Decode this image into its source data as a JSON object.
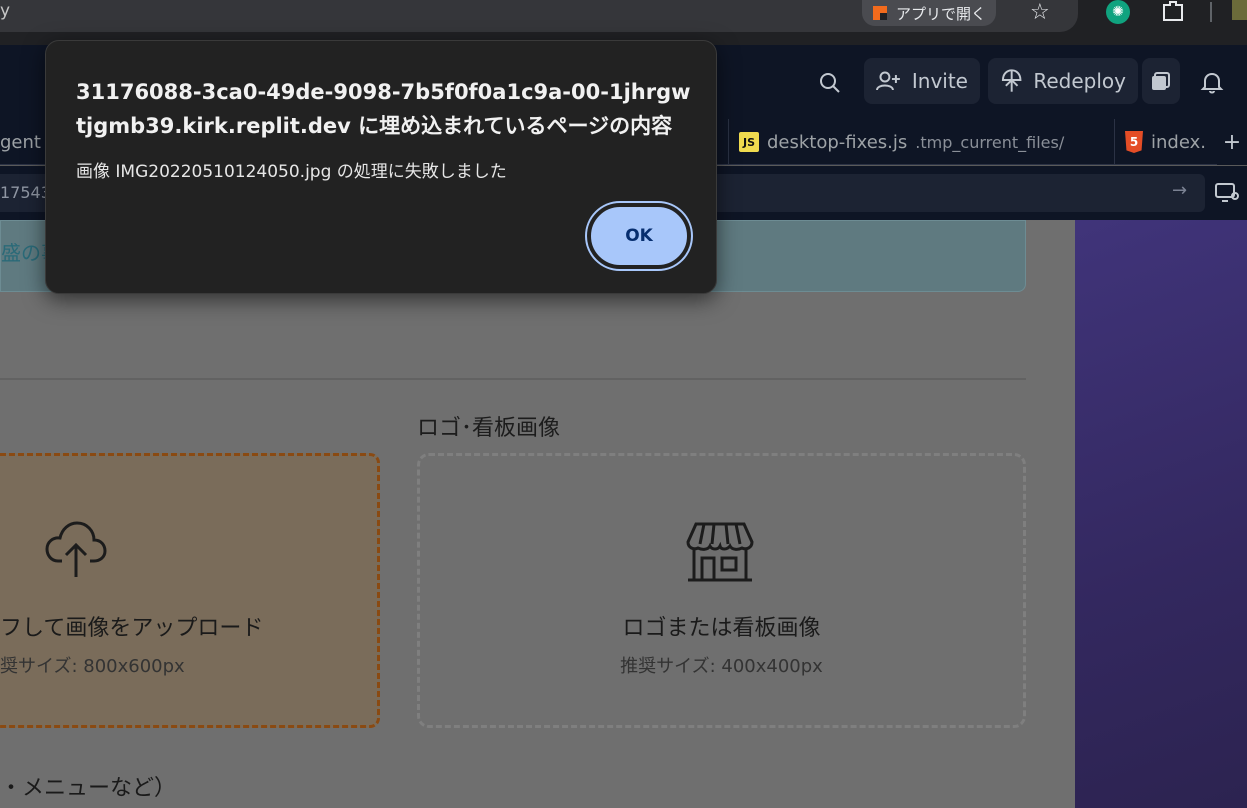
{
  "browser": {
    "url_fragment": "y",
    "open_app_label": "アプリで開く",
    "icons": [
      "app-logo-icon",
      "star-icon",
      "chatgpt-icon",
      "extensions-icon",
      "profile-icon"
    ]
  },
  "replit_header": {
    "invite_label": "Invite",
    "redeploy_label": "Redeploy",
    "icons": [
      "search-icon",
      "add-user-icon",
      "deploy-icon",
      "window-icon",
      "bell-icon"
    ]
  },
  "tabs": [
    {
      "label": "gent",
      "path": ""
    },
    {
      "label": "desktop-fixes.js",
      "path": ".tmp_current_files/"
    },
    {
      "label": "index.",
      "path": ""
    }
  ],
  "address": {
    "text": "17543"
  },
  "web": {
    "info_text": "盛の事",
    "logo_section_label": "ロゴ･看板画像",
    "upload": {
      "title": "フして画像をアップロード",
      "size": "奨サイズ: 800x600px"
    },
    "logo": {
      "title": "ロゴまたは看板画像",
      "size": "推奨サイズ: 400x400px"
    },
    "menu_text": "・メニューなど）"
  },
  "dialog": {
    "title": "31176088-3ca0-49de-9098-7b5f0f0a1c9a-00-1jhrgwtjgmb39.kirk.replit.dev に埋め込まれているページの内容",
    "message": "画像 IMG20220510124050.jpg の処理に失敗しました",
    "ok_label": "OK"
  },
  "colors": {
    "dialog_bg": "#222222",
    "ok_button": "#a8c7fa",
    "replit_bg": "#0e1525",
    "upload_border": "#8a4a12",
    "side_panel": "#40347a"
  }
}
